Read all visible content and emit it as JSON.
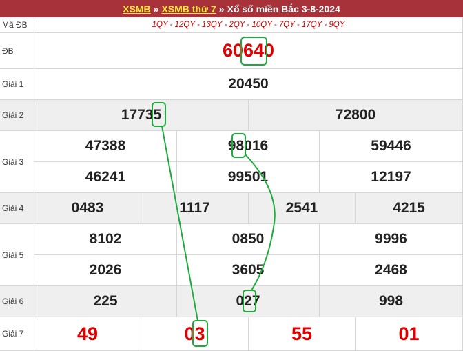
{
  "header": {
    "link1": "XSMB",
    "sep1": "»",
    "link2": "XSMB thứ 7",
    "sep2": "»",
    "title": "Xổ số miền Bắc 3-8-2024"
  },
  "ma_db": {
    "label": "Mã ĐB",
    "value": "1QY - 12QY - 13QY - 2QY - 10QY - 7QY - 17QY - 9QY"
  },
  "prizes": {
    "db": {
      "label": "ĐB",
      "numbers": [
        "60640"
      ]
    },
    "g1": {
      "label": "Giải 1",
      "numbers": [
        "20450"
      ]
    },
    "g2": {
      "label": "Giải 2",
      "numbers": [
        "17735",
        "72800"
      ]
    },
    "g3": {
      "label": "Giải 3",
      "numbers": [
        "47388",
        "98016",
        "59446",
        "46241",
        "99501",
        "12197"
      ]
    },
    "g4": {
      "label": "Giải 4",
      "numbers": [
        "0483",
        "1117",
        "2541",
        "4215"
      ]
    },
    "g5": {
      "label": "Giải 5",
      "numbers": [
        "8102",
        "0850",
        "9996",
        "2026",
        "3605",
        "2468"
      ]
    },
    "g6": {
      "label": "Giải 6",
      "numbers": [
        "225",
        "027",
        "998"
      ]
    },
    "g7": {
      "label": "Giải 7",
      "numbers": [
        "49",
        "03",
        "55",
        "01"
      ]
    }
  },
  "colors": {
    "header_bg": "#a8323a",
    "link": "#ffeb3b",
    "red_number": "#e00000",
    "highlight": "#1faa3c",
    "row_gray": "#efefef"
  }
}
